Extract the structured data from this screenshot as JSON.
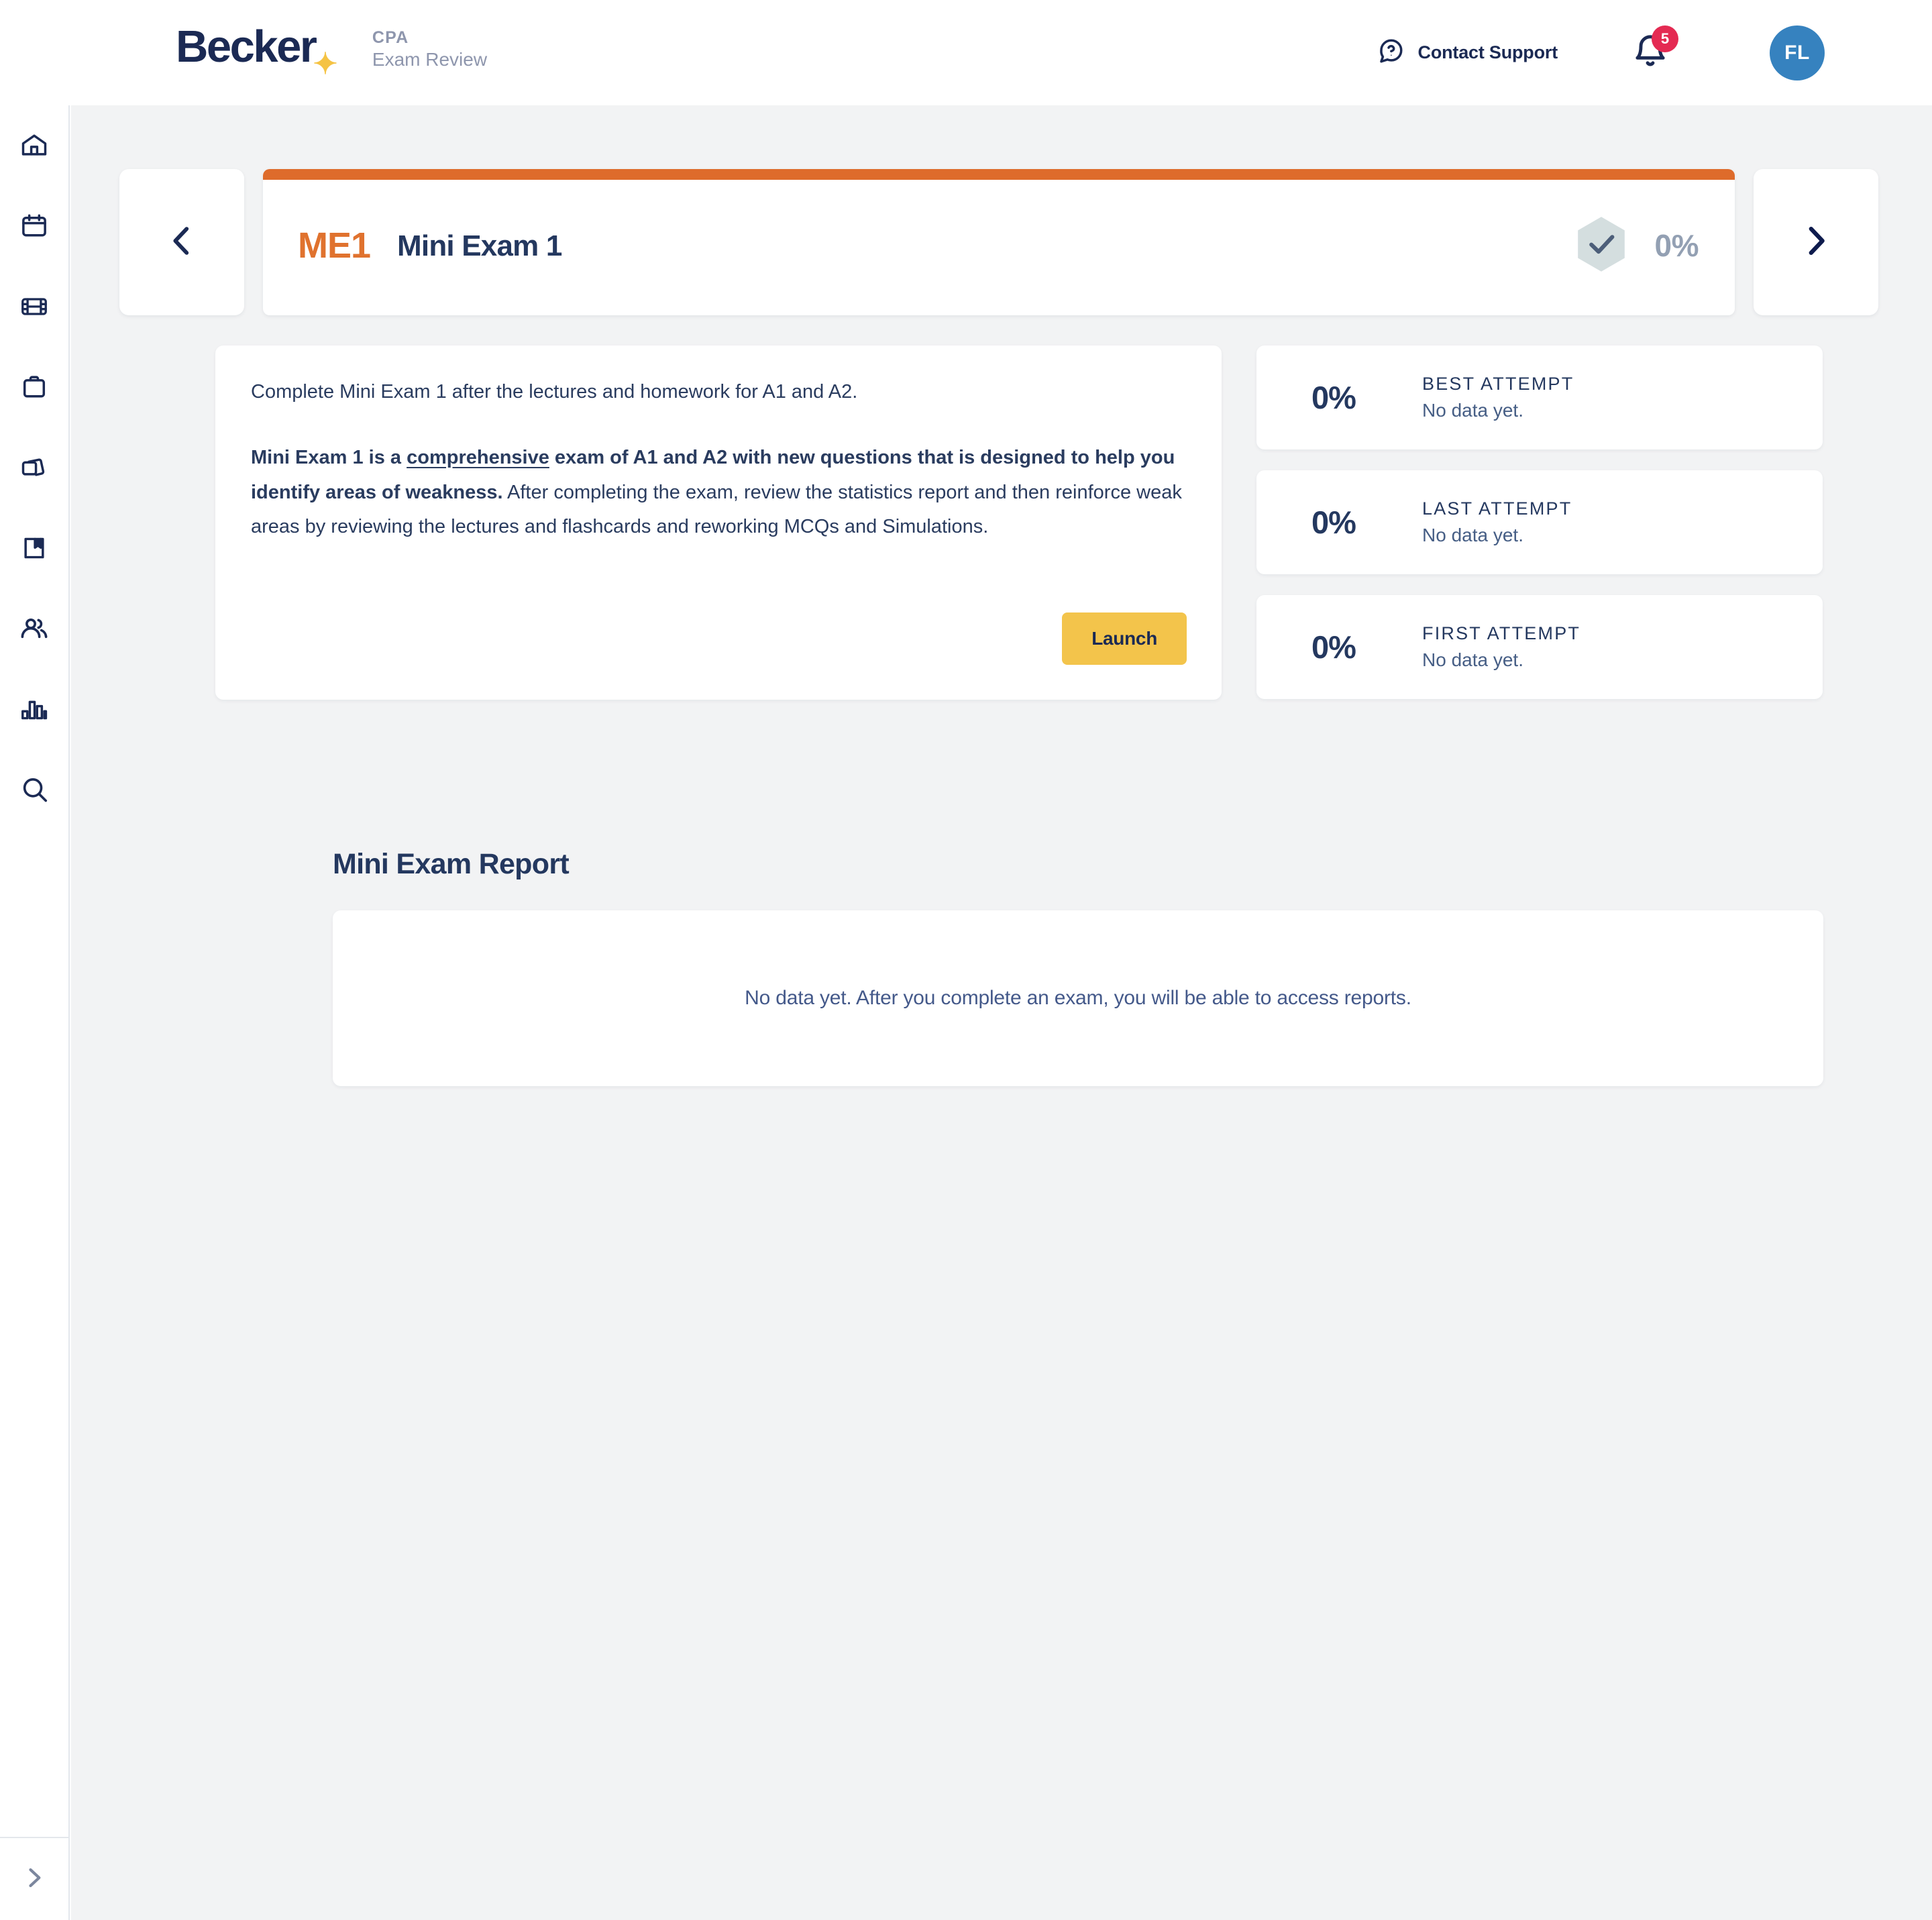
{
  "header": {
    "brand_word": "Becker",
    "brand_spark": "✦",
    "brand_sub_line1": "CPA",
    "brand_sub_line2": "Exam Review",
    "contact_support_label": "Contact Support",
    "notification_count": "5",
    "avatar_initials": "FL",
    "icons": {
      "help": "question-chat-icon",
      "bell": "bell-icon"
    }
  },
  "sidebar": {
    "items": [
      {
        "name": "home",
        "label": "Home"
      },
      {
        "name": "calendar",
        "label": "Calendar"
      },
      {
        "name": "video",
        "label": "Lectures"
      },
      {
        "name": "clipboard",
        "label": "Homework"
      },
      {
        "name": "flashcards",
        "label": "Flashcards"
      },
      {
        "name": "book",
        "label": "Textbook"
      },
      {
        "name": "people",
        "label": "Community"
      },
      {
        "name": "chart",
        "label": "Performance"
      },
      {
        "name": "search",
        "label": "Search"
      }
    ],
    "expand_label": "Expand sidebar"
  },
  "carousel": {
    "prev_label": "Previous",
    "next_label": "Next"
  },
  "exam": {
    "code": "ME1",
    "title": "Mini Exam 1",
    "progress_pct": "0%",
    "accent_color": "#DE6B2B",
    "code_color": "#E0722E",
    "badge_icon": "hexagon-check-icon"
  },
  "description": {
    "paragraph1": "Complete Mini Exam 1 after the lectures and homework for A1 and A2.",
    "bold_lead": "Mini Exam 1 is a ",
    "bold_underlined": "comprehensive",
    "bold_tail": " exam of A1 and A2 with new questions that is designed to help you identify areas of weakness.",
    "rest": " After completing the exam, review the statistics report and then reinforce weak areas by reviewing the lectures and flashcards and reworking MCQs and Simulations.",
    "launch_label": "Launch",
    "launch_color": "#F3C44B"
  },
  "stats": [
    {
      "pct": "0%",
      "label": "BEST ATTEMPT",
      "sub": "No data yet."
    },
    {
      "pct": "0%",
      "label": "LAST ATTEMPT",
      "sub": "No data yet."
    },
    {
      "pct": "0%",
      "label": "FIRST ATTEMPT",
      "sub": "No data yet."
    }
  ],
  "report": {
    "title": "Mini Exam Report",
    "empty_message": "No data yet. After you complete an exam, you will be able to access reports."
  }
}
